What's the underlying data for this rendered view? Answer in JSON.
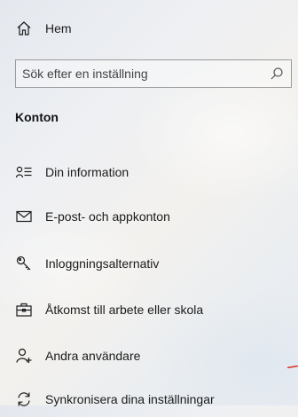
{
  "nav": {
    "home_label": "Hem",
    "home_icon": "home-icon"
  },
  "search": {
    "placeholder": "Sök efter en inställning",
    "value": "",
    "icon": "search-icon"
  },
  "section": {
    "title": "Konton"
  },
  "menu": {
    "items": [
      {
        "label": "Din information",
        "icon": "person-info-icon"
      },
      {
        "label": "E-post- och appkonton",
        "icon": "mail-icon"
      },
      {
        "label": "Inloggningsalternativ",
        "icon": "key-icon"
      },
      {
        "label": "Åtkomst till arbete eller skola",
        "icon": "briefcase-icon"
      },
      {
        "label": "Andra användare",
        "icon": "add-person-icon"
      },
      {
        "label": "Synkronisera dina inställningar",
        "icon": "sync-icon"
      }
    ]
  },
  "colors": {
    "accent_mark": "#d9342b",
    "icon_stroke": "#1b1b1b"
  }
}
